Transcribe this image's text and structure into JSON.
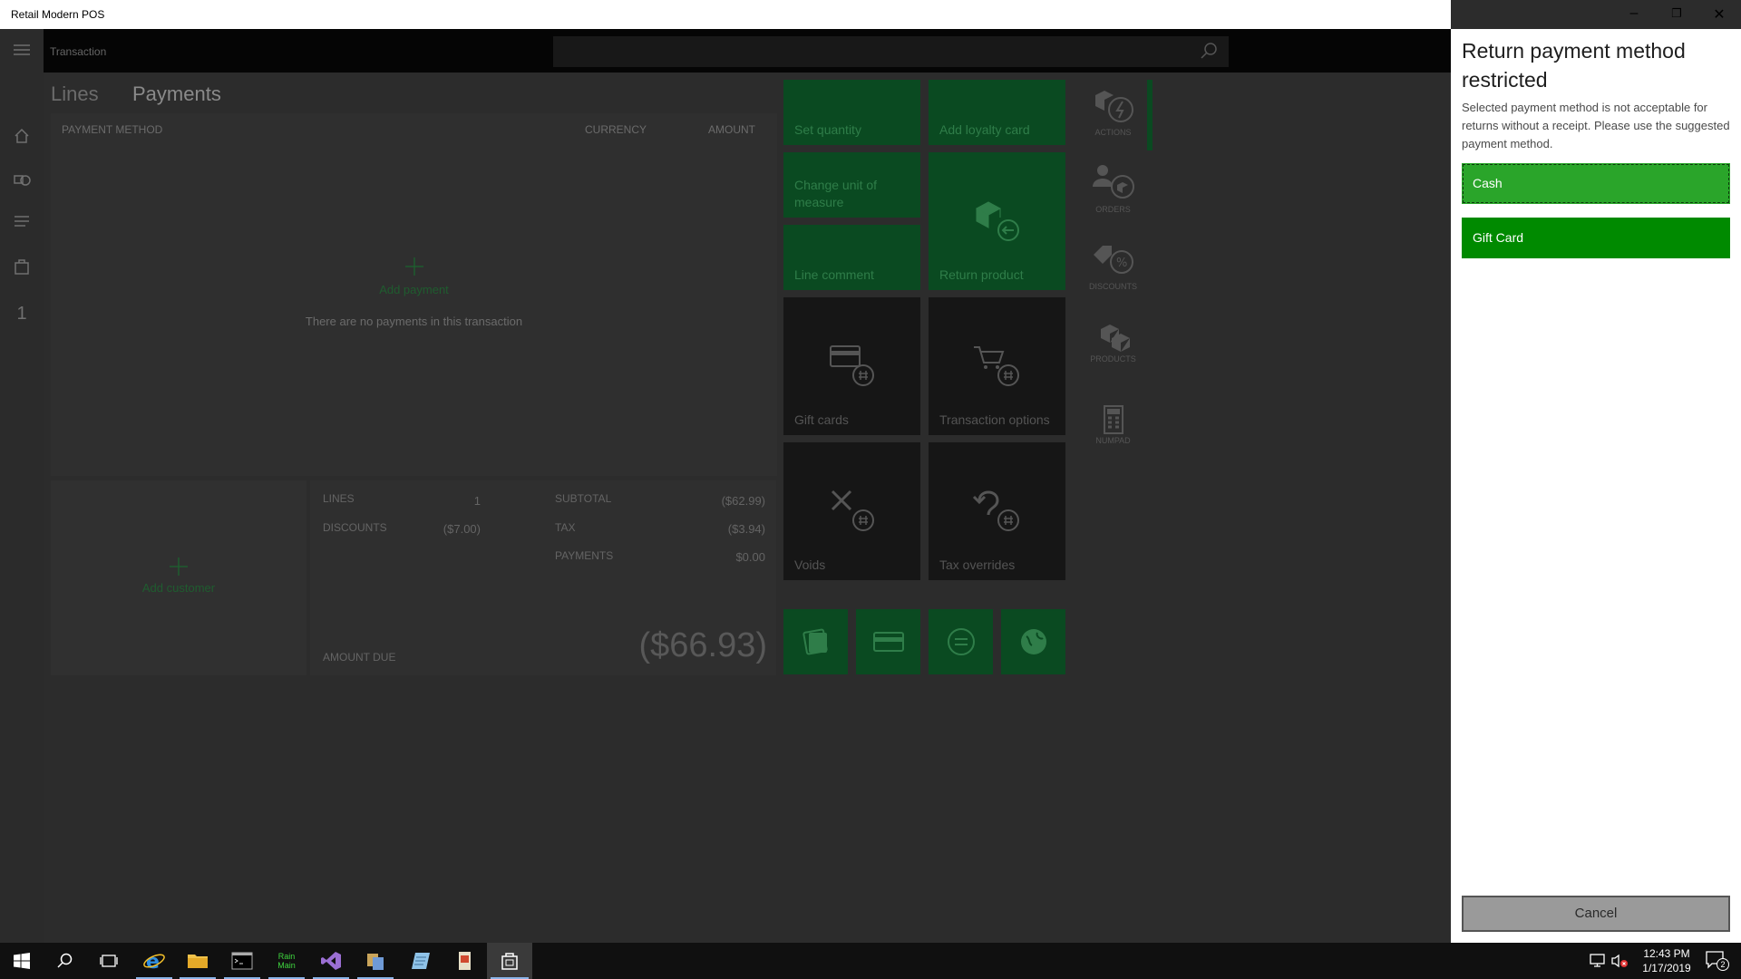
{
  "app": {
    "title": "Retail Modern POS"
  },
  "header": {
    "title": "Transaction"
  },
  "nav": {
    "count": "1"
  },
  "tabs": [
    "Lines",
    "Payments"
  ],
  "grid": {
    "columns": [
      "PAYMENT METHOD",
      "CURRENCY",
      "AMOUNT"
    ],
    "add_payment": "Add payment",
    "empty_message": "There are no payments in this transaction"
  },
  "customer": {
    "add_label": "Add customer"
  },
  "totals": {
    "lines_label": "LINES",
    "lines_value": "1",
    "discounts_label": "DISCOUNTS",
    "discounts_value": "($7.00)",
    "subtotal_label": "SUBTOTAL",
    "subtotal_value": "($62.99)",
    "tax_label": "TAX",
    "tax_value": "($3.94)",
    "payments_label": "PAYMENTS",
    "payments_value": "$0.00",
    "amount_due_label": "AMOUNT DUE",
    "amount_due_value": "($66.93)"
  },
  "tiles": {
    "set_quantity": "Set quantity",
    "add_loyalty_card": "Add loyalty card",
    "change_unit": "Change unit of measure",
    "return_product": "Return product",
    "line_comment": "Line comment",
    "gift_cards": "Gift cards",
    "transaction_options": "Transaction options",
    "voids": "Voids",
    "tax_overrides": "Tax overrides"
  },
  "toolbar": {
    "actions": "ACTIONS",
    "orders": "ORDERS",
    "discounts": "DISCOUNTS",
    "products": "PRODUCTS",
    "numpad": "NUMPAD"
  },
  "dialog": {
    "title": "Return payment method restricted",
    "message": "Selected payment method is not acceptable for returns without a receipt. Please use the suggested payment method.",
    "options": [
      "Cash",
      "Gift Card"
    ],
    "cancel": "Cancel"
  },
  "window_controls": {
    "minimize": "–",
    "restore": "❐",
    "close": "✕"
  },
  "taskbar": {
    "rain_app": "Rain Main",
    "time": "12:43 PM",
    "date": "1/17/2019",
    "notifications": "2"
  },
  "colors": {
    "accent_green": "#008a00",
    "selected_green": "#2aa52a",
    "tile_green_dimmed": "#0a4a21",
    "overlay_bg": "#2c2c2c"
  }
}
